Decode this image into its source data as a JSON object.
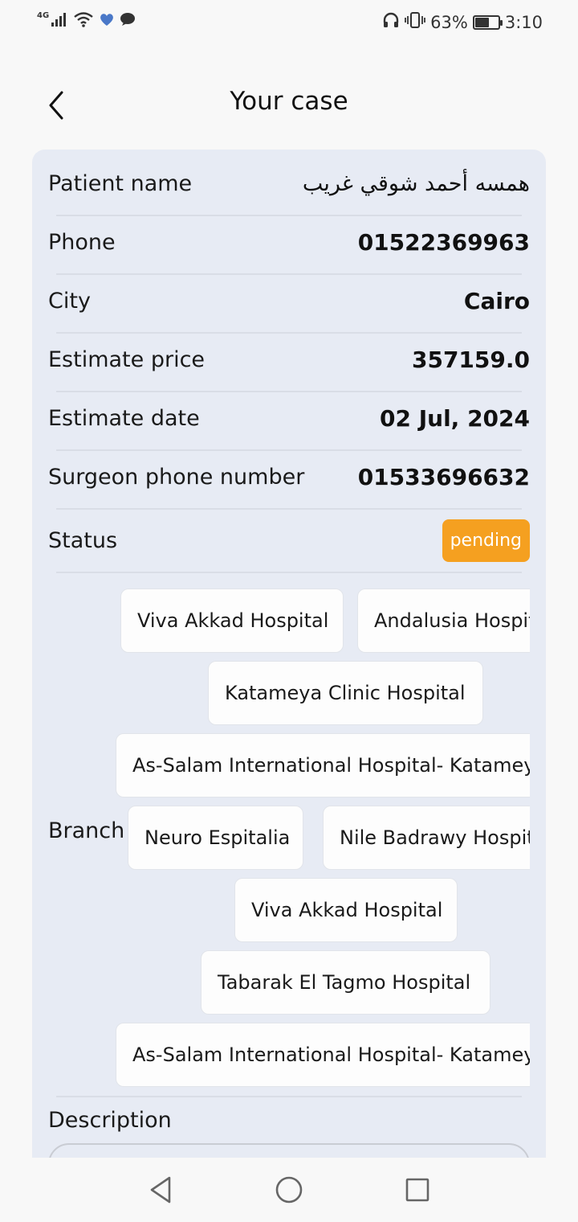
{
  "status_bar": {
    "network_tag": "4G",
    "battery_percent_text": "63%",
    "battery_level": 0.63,
    "time": "3:10",
    "icons": [
      "signal-icon",
      "wifi-icon",
      "heart-shield-icon",
      "chat-bubble-icon",
      "headphones-icon",
      "vibrate-icon",
      "battery-icon"
    ]
  },
  "header": {
    "title": "Your case"
  },
  "details": {
    "patient_name_label": "Patient name",
    "patient_name_value": "همسه أحمد شوقي غريب",
    "phone_label": "Phone",
    "phone_value": "01522369963",
    "city_label": "City",
    "city_value": "Cairo",
    "estimate_price_label": "Estimate price",
    "estimate_price_value": "357159.0",
    "estimate_date_label": "Estimate date",
    "estimate_date_value": "02 Jul, 2024",
    "surgeon_phone_label": "Surgeon phone number",
    "surgeon_phone_value": "01533696632",
    "status_label": "Status",
    "status_value": "pending",
    "status_color": "#f5a020"
  },
  "branch": {
    "label": "Branch",
    "chips": [
      "Viva Akkad Hospital",
      "Andalusia Hospital",
      "Katameya Clinic Hospital",
      "As-Salam International Hospital- Katameya",
      "Neuro Espitalia",
      "Nile Badrawy Hospital",
      "Viva Akkad Hospital",
      "Tabarak El Tagmo Hospital",
      "As-Salam International Hospital- Katameya"
    ]
  },
  "description": {
    "label": "Description"
  },
  "colors": {
    "card_background": "#e7ebf4",
    "page_background": "#f8f8f8",
    "accent_pending": "#f5a020"
  }
}
